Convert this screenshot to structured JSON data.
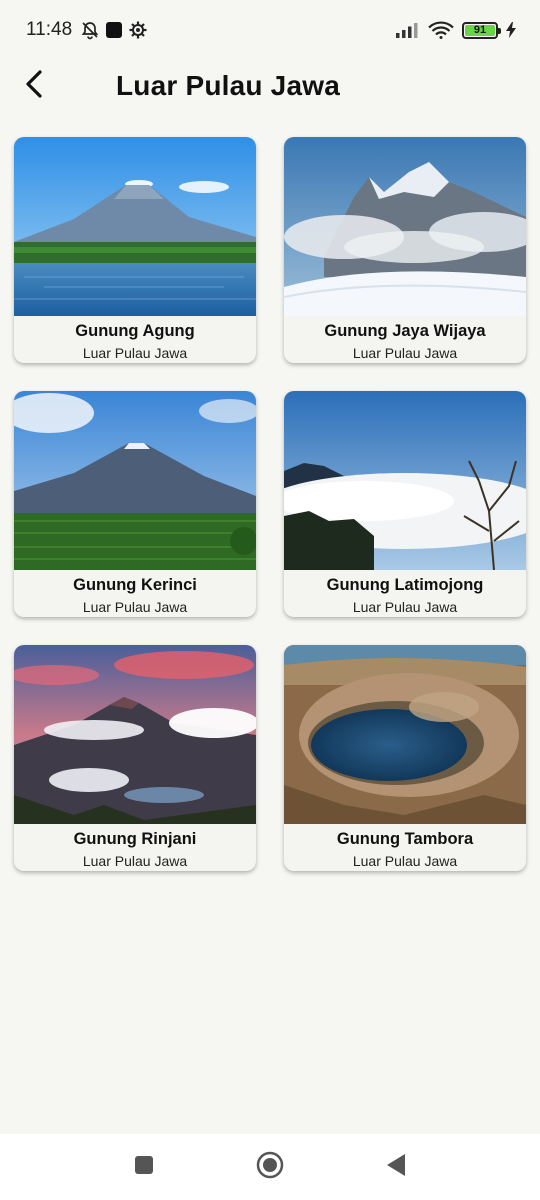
{
  "status_bar": {
    "time": "11:48",
    "battery_level": "91",
    "icons": [
      "bell-off-icon",
      "app-square-icon",
      "gear-icon",
      "signal-icon",
      "wifi-icon",
      "battery-icon",
      "charging-bolt-icon"
    ]
  },
  "header": {
    "title": "Luar Pulau Jawa",
    "back_icon": "chevron-left-icon"
  },
  "mountains": [
    {
      "name": "Gunung Agung",
      "region": "Luar Pulau Jawa"
    },
    {
      "name": "Gunung Jaya Wijaya",
      "region": "Luar Pulau Jawa"
    },
    {
      "name": "Gunung Kerinci",
      "region": "Luar Pulau Jawa"
    },
    {
      "name": "Gunung Latimojong",
      "region": "Luar Pulau Jawa"
    },
    {
      "name": "Gunung Rinjani",
      "region": "Luar Pulau Jawa"
    },
    {
      "name": "Gunung Tambora",
      "region": "Luar Pulau Jawa"
    }
  ],
  "nav_bar": {
    "icons": [
      "recents-square-icon",
      "home-circle-icon",
      "back-triangle-icon"
    ]
  },
  "colors": {
    "background": "#f6f6f2",
    "card": "#f4f4f0",
    "battery": "#6bd34a"
  }
}
